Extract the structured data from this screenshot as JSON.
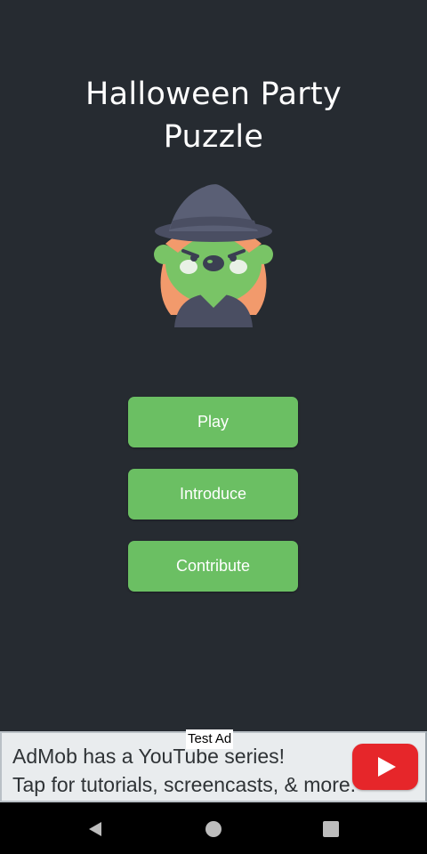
{
  "app": {
    "title_line1": "Halloween Party",
    "title_line2": "Puzzle",
    "mascot_icon": "witch-icon"
  },
  "menu": {
    "play_label": "Play",
    "introduce_label": "Introduce",
    "contribute_label": "Contribute"
  },
  "ad": {
    "badge": "Test Ad",
    "line1": "AdMob has a YouTube series!",
    "line2": "Tap for tutorials, screencasts, & more.",
    "play_icon": "youtube-play-icon"
  },
  "navbar": {
    "back_icon": "back-triangle-icon",
    "home_icon": "home-circle-icon",
    "recents_icon": "recents-square-icon"
  },
  "colors": {
    "background": "#262b31",
    "button": "#6bbf63",
    "ad_red": "#e6262a"
  }
}
